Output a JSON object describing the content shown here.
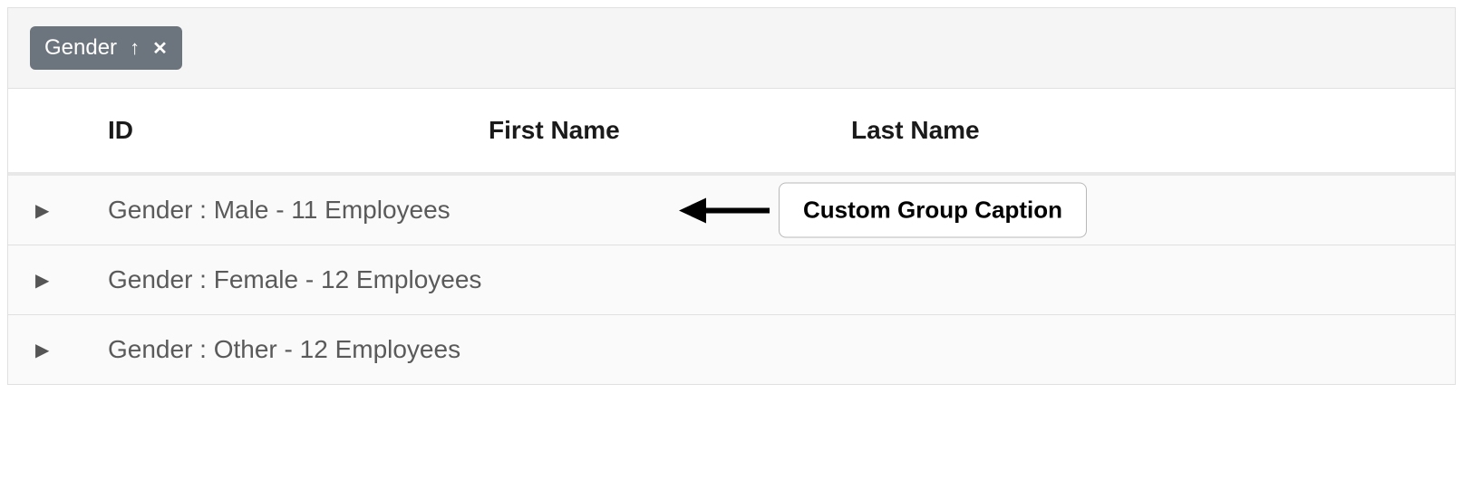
{
  "group_panel": {
    "chip_label": "Gender"
  },
  "columns": {
    "id": "ID",
    "first_name": "First Name",
    "last_name": "Last Name"
  },
  "groups": [
    {
      "caption": "Gender : Male - 11 Employees"
    },
    {
      "caption": "Gender : Female - 12 Employees"
    },
    {
      "caption": "Gender : Other - 12 Employees"
    }
  ],
  "annotation": {
    "label": "Custom Group Caption"
  }
}
